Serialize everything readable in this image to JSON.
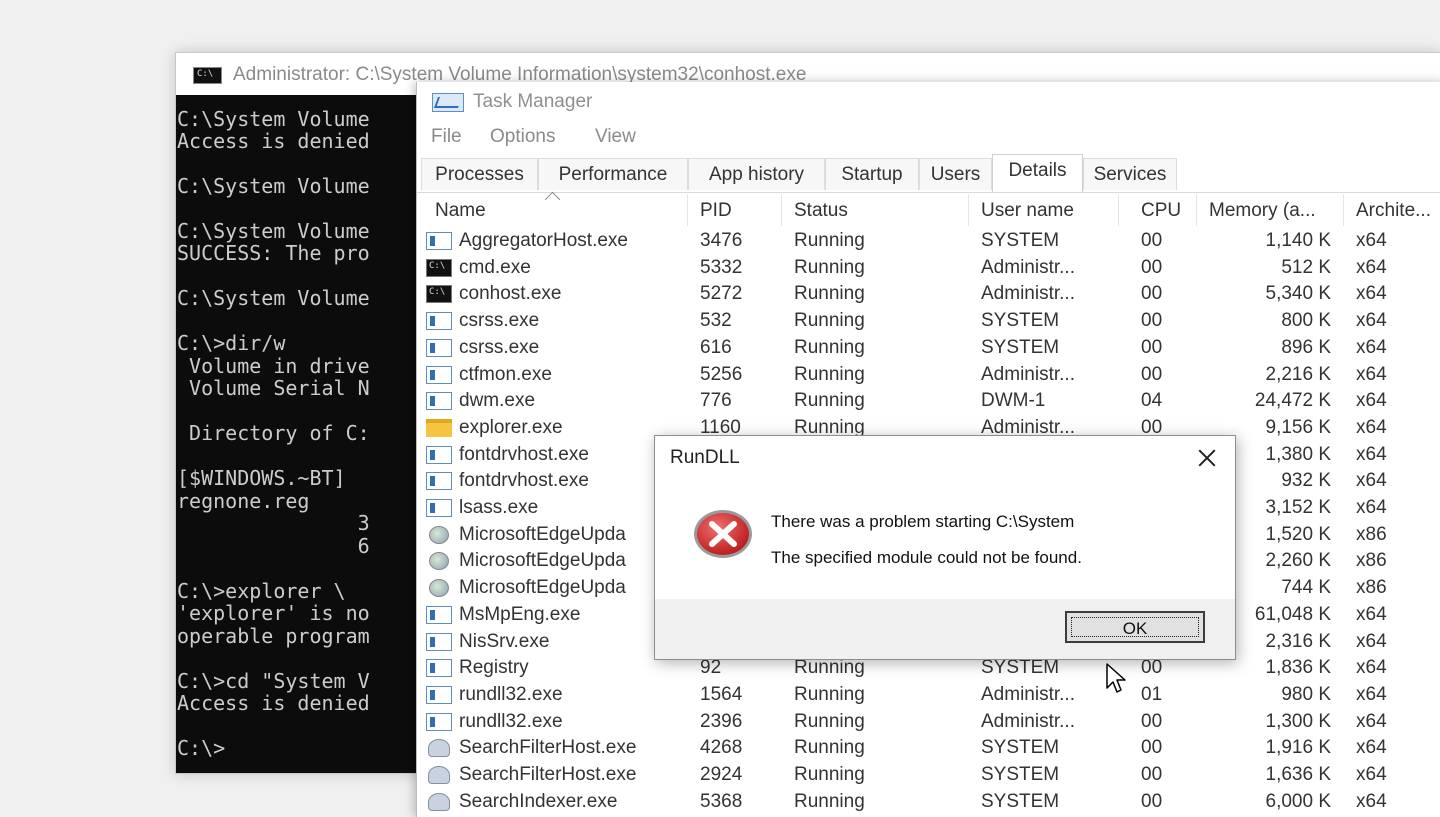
{
  "console": {
    "title": "Administrator: C:\\System Volume Information\\system32\\conhost.exe",
    "lines": [
      "C:\\System Volume",
      "Access is denied",
      "",
      "C:\\System Volume",
      "",
      "C:\\System Volume",
      "SUCCESS: The pro",
      "",
      "C:\\System Volume",
      "",
      "C:\\>dir/w",
      " Volume in drive",
      " Volume Serial N",
      "",
      " Directory of C:",
      "",
      "[$WINDOWS.~BT]",
      "regnone.reg",
      "               3",
      "               6",
      "",
      "",
      "C:\\>explorer \\",
      "'explorer' is no",
      "operable program",
      "",
      "C:\\>cd \"System V",
      "Access is denied",
      "",
      "C:\\>"
    ]
  },
  "task_manager": {
    "title": "Task Manager",
    "menu": [
      "File",
      "Options",
      "View"
    ],
    "tabs": [
      "Processes",
      "Performance",
      "App history",
      "Startup",
      "Users",
      "Details",
      "Services"
    ],
    "active_tab": "Details",
    "columns": [
      "Name",
      "PID",
      "Status",
      "User name",
      "CPU",
      "Memory (a...",
      "Archite..."
    ],
    "rows": [
      {
        "icon": "service-icon",
        "name": "AggregatorHost.exe",
        "pid": "3476",
        "status": "Running",
        "user": "SYSTEM",
        "cpu": "00",
        "memory": "1,140 K",
        "arch": "x64"
      },
      {
        "icon": "console-icon",
        "name": "cmd.exe",
        "pid": "5332",
        "status": "Running",
        "user": "Administr...",
        "cpu": "00",
        "memory": "512 K",
        "arch": "x64"
      },
      {
        "icon": "console-icon",
        "name": "conhost.exe",
        "pid": "5272",
        "status": "Running",
        "user": "Administr...",
        "cpu": "00",
        "memory": "5,340 K",
        "arch": "x64"
      },
      {
        "icon": "service-icon",
        "name": "csrss.exe",
        "pid": "532",
        "status": "Running",
        "user": "SYSTEM",
        "cpu": "00",
        "memory": "800 K",
        "arch": "x64"
      },
      {
        "icon": "service-icon",
        "name": "csrss.exe",
        "pid": "616",
        "status": "Running",
        "user": "SYSTEM",
        "cpu": "00",
        "memory": "896 K",
        "arch": "x64"
      },
      {
        "icon": "service-icon",
        "name": "ctfmon.exe",
        "pid": "5256",
        "status": "Running",
        "user": "Administr...",
        "cpu": "00",
        "memory": "2,216 K",
        "arch": "x64"
      },
      {
        "icon": "service-icon",
        "name": "dwm.exe",
        "pid": "776",
        "status": "Running",
        "user": "DWM-1",
        "cpu": "04",
        "memory": "24,472 K",
        "arch": "x64"
      },
      {
        "icon": "folder-icon",
        "name": "explorer.exe",
        "pid": "1160",
        "status": "Running",
        "user": "Administr...",
        "cpu": "00",
        "memory": "9,156 K",
        "arch": "x64"
      },
      {
        "icon": "service-icon",
        "name": "fontdrvhost.exe",
        "pid": "",
        "status": "",
        "user": "",
        "cpu": "",
        "memory": "1,380 K",
        "arch": "x64"
      },
      {
        "icon": "service-icon",
        "name": "fontdrvhost.exe",
        "pid": "",
        "status": "",
        "user": "",
        "cpu": "",
        "memory": "932 K",
        "arch": "x64"
      },
      {
        "icon": "service-icon",
        "name": "lsass.exe",
        "pid": "",
        "status": "",
        "user": "",
        "cpu": "",
        "memory": "3,152 K",
        "arch": "x64"
      },
      {
        "icon": "edge-update-icon",
        "name": "MicrosoftEdgeUpda",
        "pid": "",
        "status": "",
        "user": "",
        "cpu": "",
        "memory": "1,520 K",
        "arch": "x86"
      },
      {
        "icon": "edge-update-icon",
        "name": "MicrosoftEdgeUpda",
        "pid": "",
        "status": "",
        "user": "",
        "cpu": "",
        "memory": "2,260 K",
        "arch": "x86"
      },
      {
        "icon": "edge-update-icon",
        "name": "MicrosoftEdgeUpda",
        "pid": "",
        "status": "",
        "user": "",
        "cpu": "",
        "memory": "744 K",
        "arch": "x86"
      },
      {
        "icon": "service-icon",
        "name": "MsMpEng.exe",
        "pid": "",
        "status": "",
        "user": "",
        "cpu": "",
        "memory": "61,048 K",
        "arch": "x64"
      },
      {
        "icon": "service-icon",
        "name": "NisSrv.exe",
        "pid": "",
        "status": "",
        "user": "",
        "cpu": "",
        "memory": "2,316 K",
        "arch": "x64"
      },
      {
        "icon": "service-icon",
        "name": "Registry",
        "pid": "92",
        "status": "Running",
        "user": "SYSTEM",
        "cpu": "00",
        "memory": "1,836 K",
        "arch": "x64"
      },
      {
        "icon": "service-icon",
        "name": "rundll32.exe",
        "pid": "1564",
        "status": "Running",
        "user": "Administr...",
        "cpu": "01",
        "memory": "980 K",
        "arch": "x64"
      },
      {
        "icon": "service-icon",
        "name": "rundll32.exe",
        "pid": "2396",
        "status": "Running",
        "user": "Administr...",
        "cpu": "00",
        "memory": "1,300 K",
        "arch": "x64"
      },
      {
        "icon": "search-host-icon",
        "name": "SearchFilterHost.exe",
        "pid": "4268",
        "status": "Running",
        "user": "SYSTEM",
        "cpu": "00",
        "memory": "1,916 K",
        "arch": "x64"
      },
      {
        "icon": "search-host-icon",
        "name": "SearchFilterHost.exe",
        "pid": "2924",
        "status": "Running",
        "user": "SYSTEM",
        "cpu": "00",
        "memory": "1,636 K",
        "arch": "x64"
      },
      {
        "icon": "search-host-icon",
        "name": "SearchIndexer.exe",
        "pid": "5368",
        "status": "Running",
        "user": "SYSTEM",
        "cpu": "00",
        "memory": "6,000 K",
        "arch": "x64"
      }
    ]
  },
  "dialog": {
    "title": "RunDLL",
    "message_line1": "There was a problem starting C:\\System",
    "message_line2": "The specified module could not be found.",
    "ok_label": "OK",
    "icon": "error-icon"
  },
  "colors": {
    "console_bg": "#0c0c0c",
    "console_text": "#cccccc",
    "error_red": "#d42a2a"
  }
}
